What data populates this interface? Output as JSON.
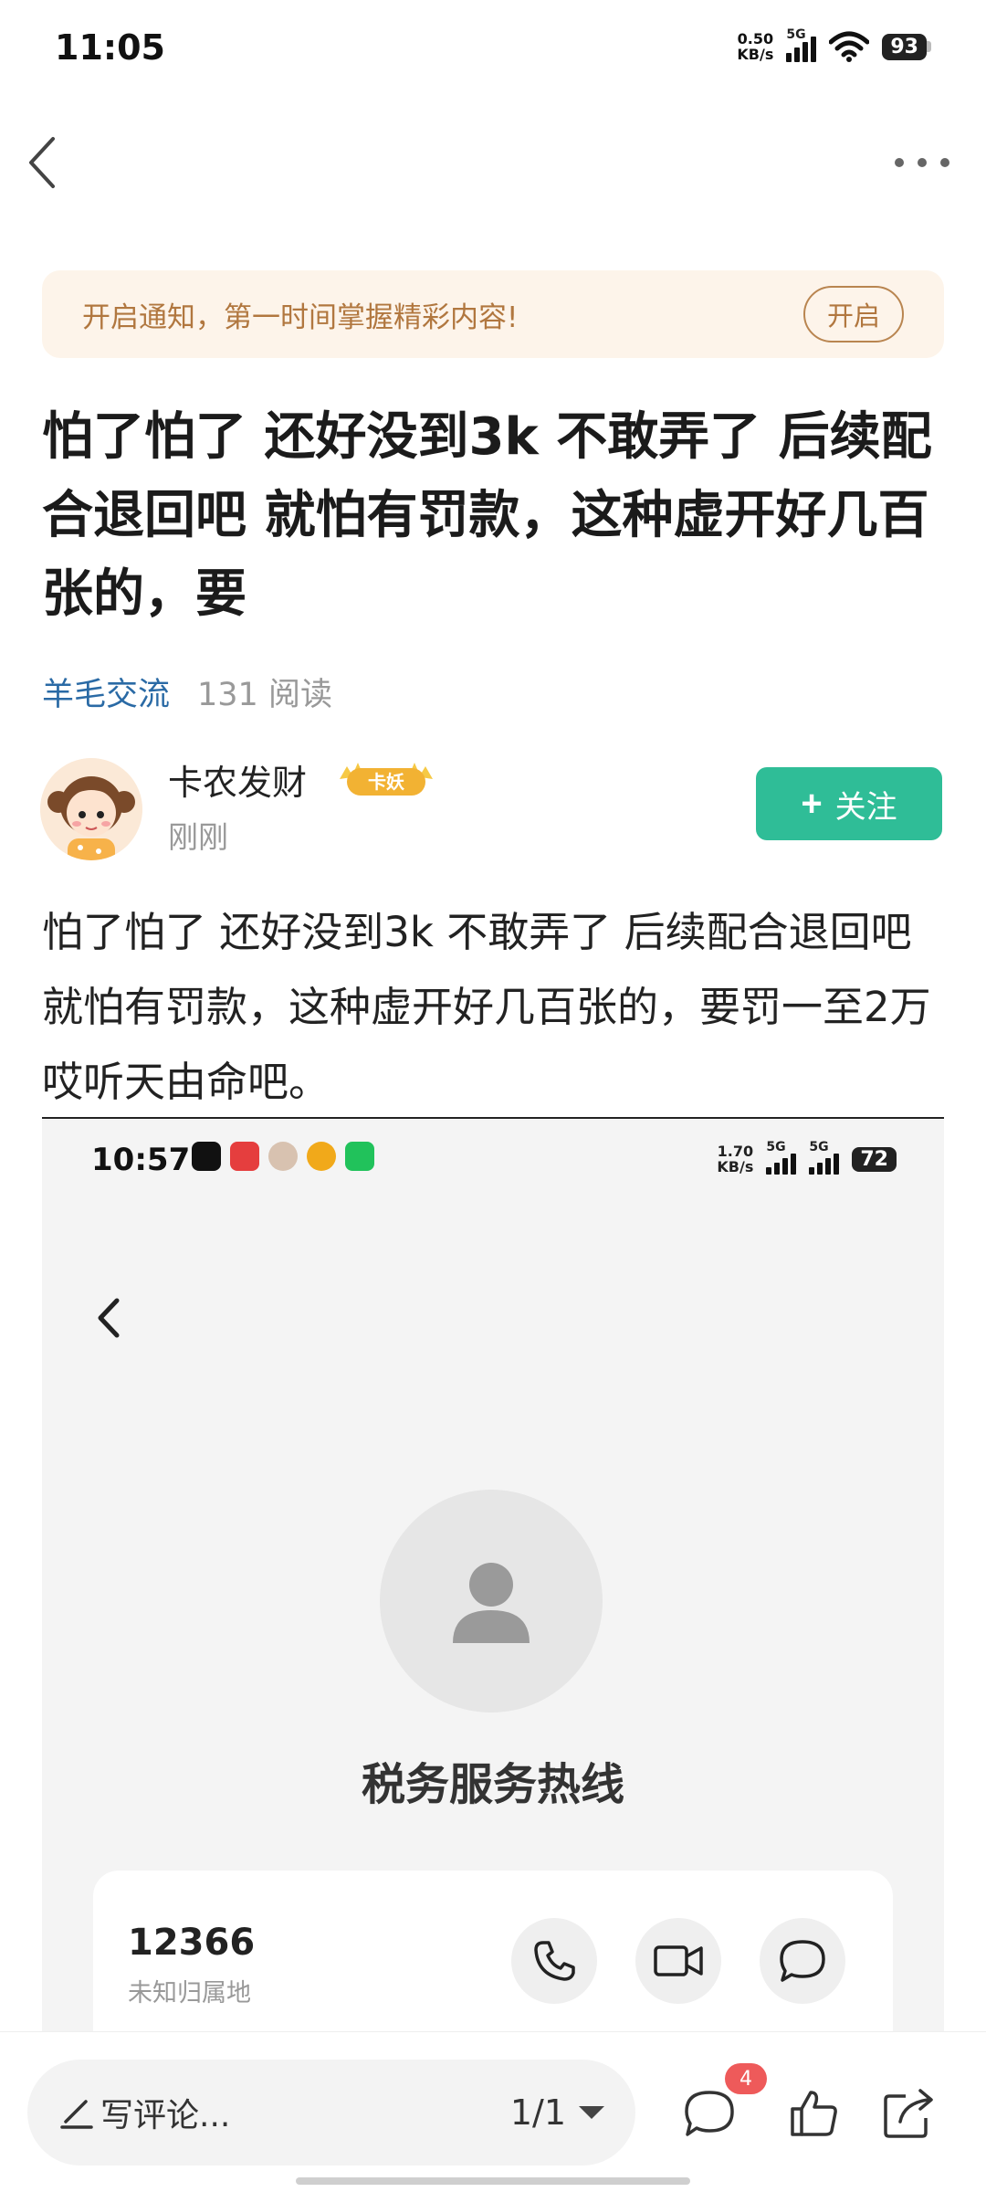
{
  "status_bar": {
    "time": "11:05",
    "net_speed_value": "0.50",
    "net_speed_unit": "KB/s",
    "network": "5G",
    "battery": "93"
  },
  "notice": {
    "text": "开启通知，第一时间掌握精彩内容!",
    "button_label": "开启"
  },
  "post": {
    "title": "怕了怕了 还好没到3k 不敢弄了 后续配合退回吧 就怕有罚款，这种虚开好几百张的，要",
    "category": "羊毛交流",
    "reads": "131 阅读",
    "author": {
      "name": "卡农发财",
      "badge": "卡妖",
      "time": "刚刚"
    },
    "follow_label": "关注",
    "body": "怕了怕了 还好没到3k  不敢弄了 后续配合退回吧 就怕有罚款，这种虚开好几百张的，要罚一至2万  哎听天由命吧。"
  },
  "embedded_screenshot": {
    "time": "10:57",
    "net_speed_value": "1.70",
    "net_speed_unit": "KB/s",
    "network_1": "5G",
    "network_2": "5G",
    "battery": "72",
    "contact_title": "税务服务热线",
    "phone_number": "12366",
    "location": "未知归属地"
  },
  "bottom_bar": {
    "comment_placeholder": "写评论...",
    "page_indicator": "1/1",
    "comment_count": "4"
  },
  "colors": {
    "accent_green": "#2fbd97",
    "notice_bg": "#fdf4ea",
    "notice_text": "#b1773f",
    "category_blue": "#2a6aa5",
    "badge_red": "#ee5a5a"
  }
}
